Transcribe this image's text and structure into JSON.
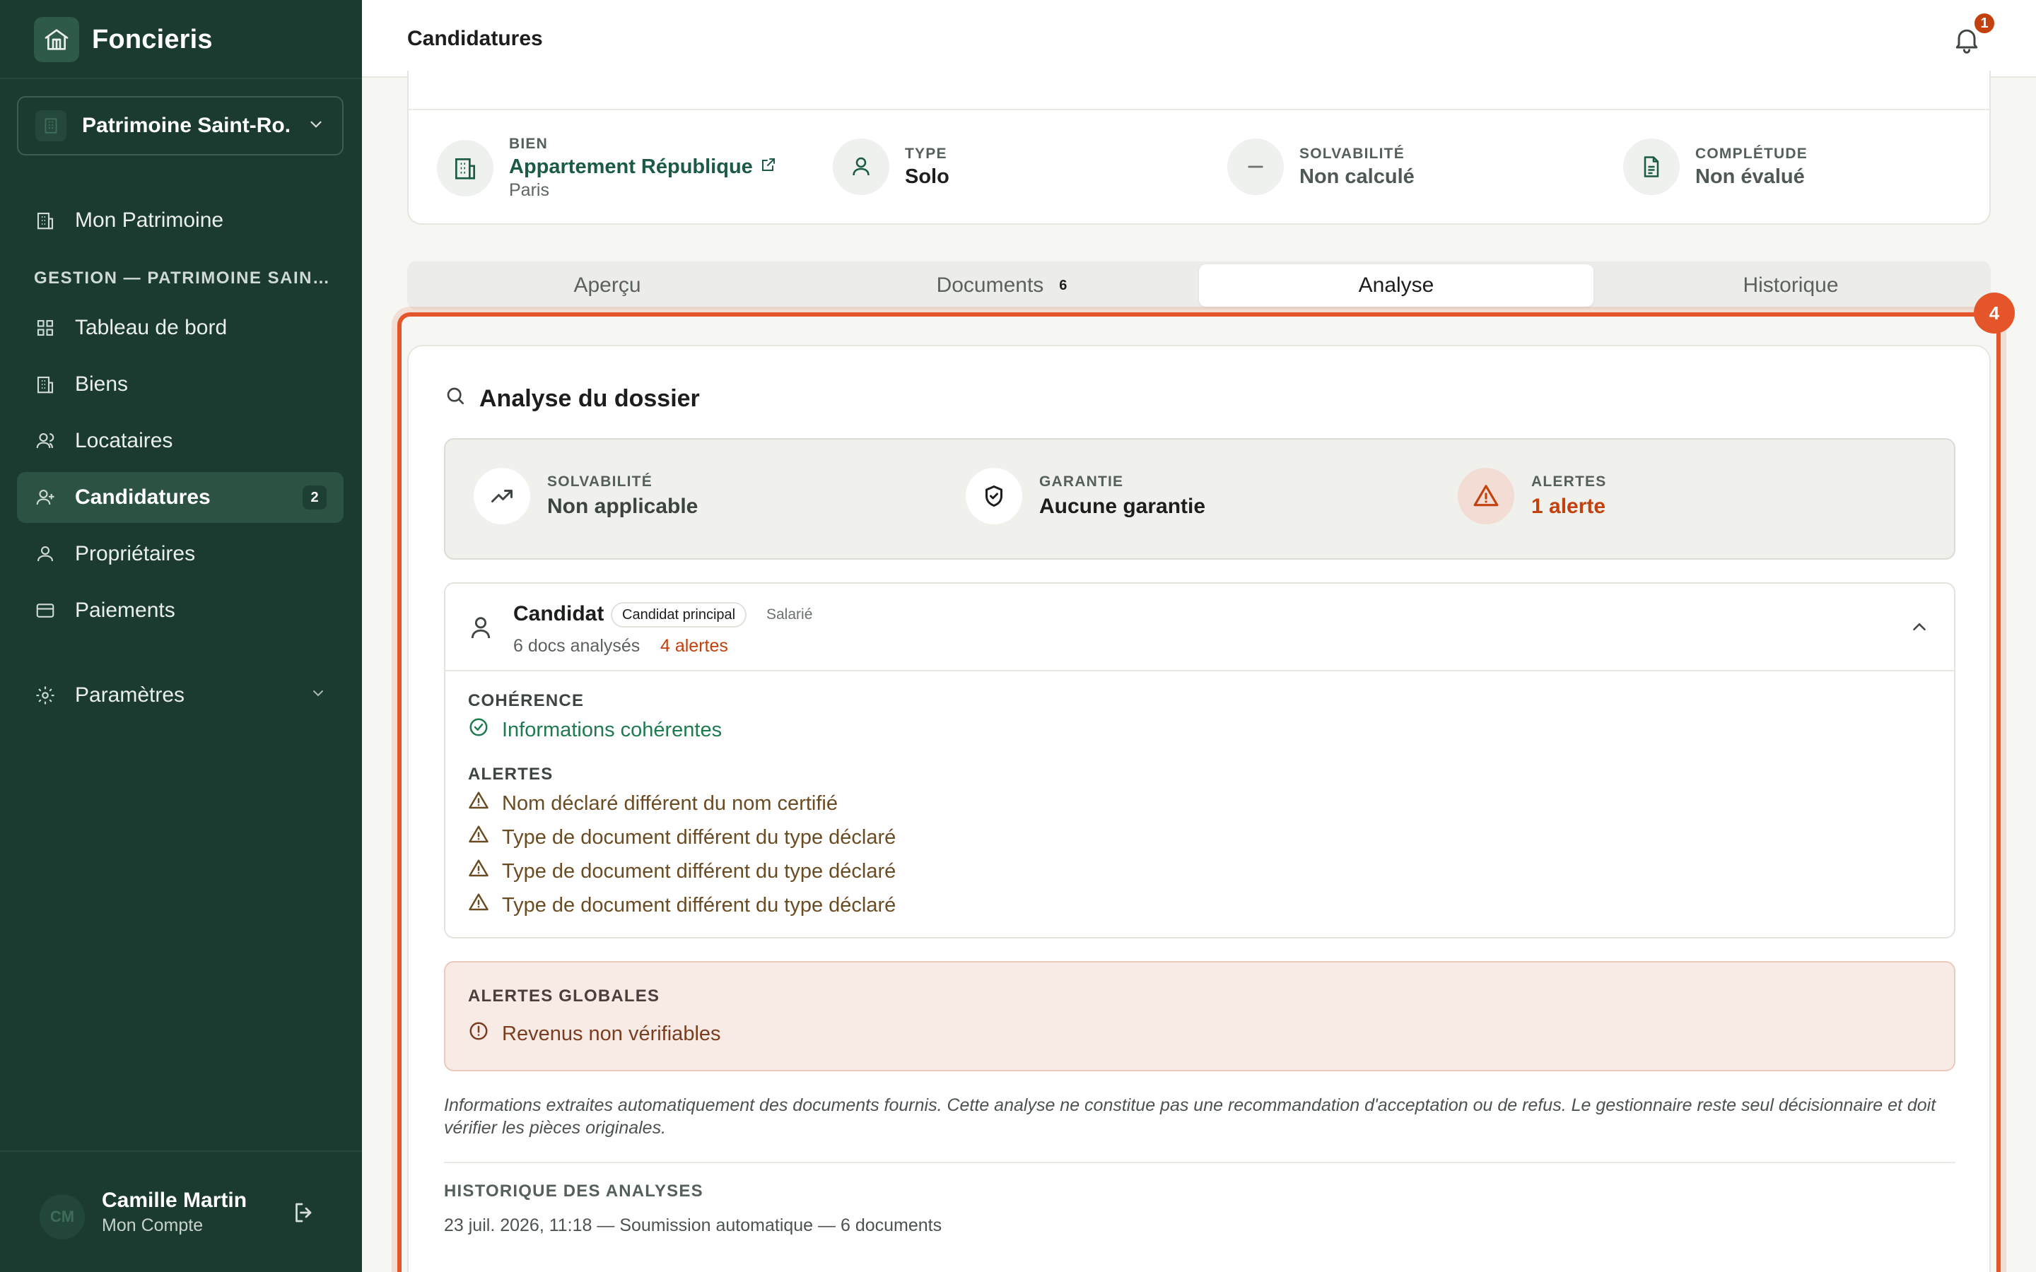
{
  "app": {
    "name": "Foncieris"
  },
  "sidebar": {
    "patrimoine_select": "Patrimoine Saint-Ro...",
    "nav_top": {
      "label": "Mon Patrimoine"
    },
    "section_label": "GESTION — PATRIMOINE SAINT-ROCH",
    "items": [
      {
        "label": "Tableau de bord",
        "icon": "dashboard-icon"
      },
      {
        "label": "Biens",
        "icon": "building-icon"
      },
      {
        "label": "Locataires",
        "icon": "user-icon"
      },
      {
        "label": "Candidatures",
        "icon": "user-plus-icon",
        "badge": "2",
        "active": true
      },
      {
        "label": "Propriétaires",
        "icon": "user-icon"
      },
      {
        "label": "Paiements",
        "icon": "card-icon"
      }
    ],
    "settings": {
      "label": "Paramètres"
    },
    "user": {
      "initials": "CM",
      "name": "Camille Martin",
      "subtitle": "Mon Compte"
    }
  },
  "topbar": {
    "title": "Candidatures",
    "notifications_count": "1"
  },
  "summary": {
    "bien": {
      "label": "BIEN",
      "value": "Appartement République",
      "sub": "Paris"
    },
    "type": {
      "label": "TYPE",
      "value": "Solo"
    },
    "solvabilite": {
      "label": "SOLVABILITÉ",
      "value": "Non calculé"
    },
    "completude": {
      "label": "COMPLÉTUDE",
      "value": "Non évalué"
    }
  },
  "tabs": [
    {
      "label": "Aperçu"
    },
    {
      "label": "Documents",
      "count": "6"
    },
    {
      "label": "Analyse",
      "active": true
    },
    {
      "label": "Historique"
    }
  ],
  "highlight": {
    "step": "4",
    "color": "#e5552a"
  },
  "analysis": {
    "title": "Analyse du dossier",
    "stats": {
      "solvabilite": {
        "label": "SOLVABILITÉ",
        "value": "Non applicable"
      },
      "garantie": {
        "label": "GARANTIE",
        "value": "Aucune garantie"
      },
      "alertes": {
        "label": "ALERTES",
        "value": "1 alerte"
      }
    },
    "candidate": {
      "name": "Candidat",
      "chip": "Candidat principal",
      "role": "Salarié",
      "docs": "6 docs analysés",
      "alerts": "4 alertes",
      "coherence_label": "COHÉRENCE",
      "coherence_value": "Informations cohérentes",
      "alerts_label": "ALERTES",
      "alert_items": [
        "Nom déclaré différent du nom certifié",
        "Type de document différent du type déclaré",
        "Type de document différent du type déclaré",
        "Type de document différent du type déclaré"
      ]
    },
    "global_alerts": {
      "label": "ALERTES GLOBALES",
      "items": [
        "Revenus non vérifiables"
      ]
    },
    "disclaimer": "Informations extraites automatiquement des documents fournis. Cette analyse ne constitue pas une recommandation d'acceptation ou de refus. Le gestionnaire reste seul décisionnaire et doit vérifier les pièces originales.",
    "history": {
      "label": "HISTORIQUE DES ANALYSES",
      "entry": "23 juil. 2026, 11:18 — Soumission automatique — 6 documents"
    }
  },
  "colors": {
    "sidebar": "#1b3b30",
    "accent_green": "#1b5b43",
    "alert_orange": "#c2410c"
  }
}
